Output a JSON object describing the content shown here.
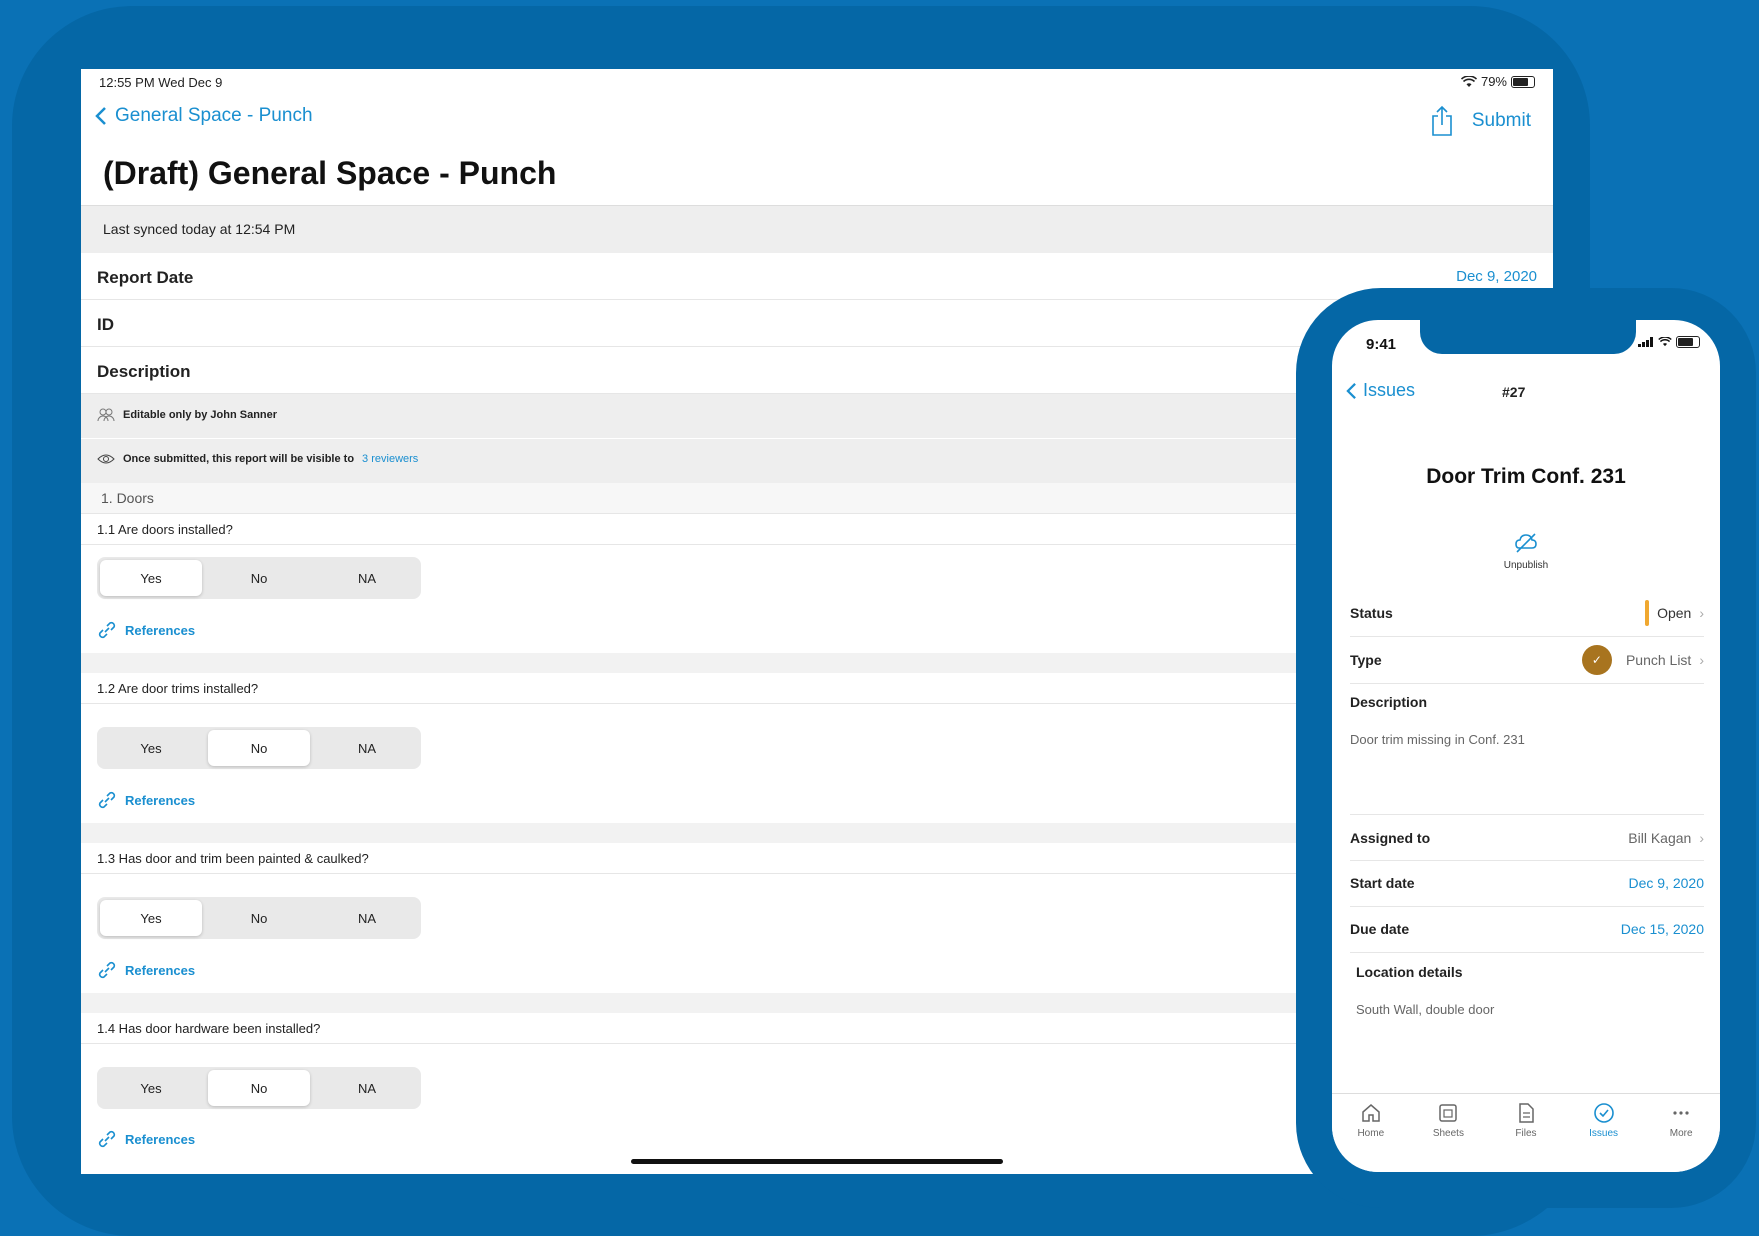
{
  "tablet": {
    "status_time": "12:55 PM   Wed Dec 9",
    "battery": "79%",
    "back_label": "General Space - Punch",
    "submit_label": "Submit",
    "title": "(Draft) General Space - Punch",
    "synced": "Last synced today at 12:54 PM",
    "report_date_label": "Report Date",
    "report_date_value": "Dec 9, 2020",
    "id_label": "ID",
    "description_label": "Description",
    "editable_note": "Editable only by John Sanner",
    "visibility_note": "Once submitted, this report will be visible to",
    "reviewers_link": "3 reviewers",
    "section_label": "1. Doors",
    "questions": [
      {
        "text": "1.1 Are doors installed?",
        "options": [
          "Yes",
          "No",
          "NA"
        ],
        "selected": "Yes",
        "references": "References"
      },
      {
        "text": "1.2 Are door trims installed?",
        "options": [
          "Yes",
          "No",
          "NA"
        ],
        "selected": "No",
        "references": "References"
      },
      {
        "text": "1.3 Has door and trim been painted & caulked?",
        "options": [
          "Yes",
          "No",
          "NA"
        ],
        "selected": "Yes",
        "references": "References"
      },
      {
        "text": "1.4 Has door hardware been installed?",
        "options": [
          "Yes",
          "No",
          "NA"
        ],
        "selected": "No",
        "references": "References"
      }
    ]
  },
  "phone": {
    "time": "9:41",
    "back_label": "Issues",
    "issue_number": "#27",
    "title": "Door Trim Conf. 231",
    "unpublish_label": "Unpublish",
    "status_label": "Status",
    "status_value": "Open",
    "type_label": "Type",
    "type_value": "Punch List",
    "description_label": "Description",
    "description_value": "Door trim missing in Conf. 231",
    "assigned_label": "Assigned to",
    "assigned_value": "Bill Kagan",
    "start_label": "Start date",
    "start_value": "Dec 9, 2020",
    "due_label": "Due date",
    "due_value": "Dec 15, 2020",
    "location_label": "Location details",
    "location_value": "South Wall, double door",
    "tabs": [
      "Home",
      "Sheets",
      "Files",
      "Issues",
      "More"
    ],
    "active_tab": "Issues"
  },
  "colors": {
    "accent": "#1a8fd0",
    "frame": "#0567a6",
    "background": "#0a71b5",
    "status_open": "#f0a830",
    "type_badge": "#a8741f"
  }
}
